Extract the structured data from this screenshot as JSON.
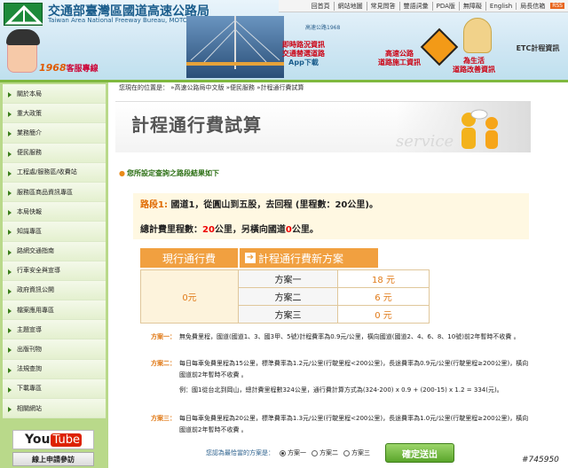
{
  "header": {
    "org_title": "交通部臺灣區國道高速公路局",
    "org_subtitle": "Taiwan Area National Freeway Bureau, MOTC",
    "hotline_label": "客服專線",
    "hotline_number": "1968",
    "app_tag": "高速公路1968",
    "promo_app": "App下載",
    "promo_app_line1": "即時路況資訊",
    "promo_app_line2": "交通替選道路",
    "promo_road_line1": "高速公路",
    "promo_road_line2": "道路施工資訊",
    "promo_etc": "ETC計程資訊",
    "promo_life_line1": "為生活",
    "promo_life_line2": "道路改善資訊"
  },
  "topnav": {
    "items": [
      "回首頁",
      "網站地圖",
      "常見問答",
      "雙語詞彙",
      "PDA版",
      "無障礙",
      "English",
      "局長信箱"
    ],
    "rss": "RSS"
  },
  "sidebar": {
    "items": [
      "關於本局",
      "重大政策",
      "業務簡介",
      "便民服務",
      "工程處/服務區/收費站",
      "服務區商品資訊專區",
      "本局快報",
      "知識專區",
      "路網交通指南",
      "行車安全與宣導",
      "政府資訊公開",
      "檔案應用專區",
      "主題宣導",
      "出版刊物",
      "法規查詢",
      "下載專區",
      "相關網站"
    ],
    "youtube_you": "You",
    "youtube_tube": "Tube",
    "apply_label": "線上申請參訪"
  },
  "breadcrumb": {
    "prefix": "您現在的位置是：",
    "path": "»高速公路局中文版 »便民服務 »計程通行費試算"
  },
  "banner": {
    "title": "計程通行費試算",
    "service_word": "service"
  },
  "result": {
    "heading": "您所設定查詢之路段結果如下",
    "route_label": "路段1:",
    "route_text": "國道1，從圓山到五股，去回程 (里程數：20公里)。",
    "dist_prefix": "總計費里程數：",
    "dist_value": "20",
    "dist_mid": "公里，另橫向國道",
    "dist_value2": "0",
    "dist_suffix": "公里。"
  },
  "fees": {
    "tab_current": "現行通行費",
    "tab_new": "計程通行費新方案",
    "current_value": "0元",
    "plans": [
      {
        "name": "方案一",
        "value": "18 元"
      },
      {
        "name": "方案二",
        "value": "6 元"
      },
      {
        "name": "方案三",
        "value": "0 元"
      }
    ]
  },
  "notes": {
    "n1_label": "方案一：",
    "n1_text": "無免費里程，國道(國道1、3、國3甲、5號)計程費率為0.9元/公里，橫向國道(國道2、4、6、8、10號)前2年暫時不收費 。",
    "n2_label": "方案二：",
    "n2_text": "每日每車免費里程為15公里，標準費率為1.2元/公里(行駛里程<200公里)，長途費率為0.9元/公里(行駛里程≥200公里)，橫向國道前2年暫時不收費 。",
    "n3_text": "例：國1從台北到岡山，總計費里程數324公里，通行費計算方式為(324-200) x 0.9 + (200-15) x 1.2 = 334(元)。",
    "n4_label": "方案三：",
    "n4_text": "每日每車免費里程為20公里，標準費率為1.3元/公里(行駛里程<200公里)，長途費率為1.0元/公里(行駛里程≥200公里)，橫向國道前2年暫時不收費 。"
  },
  "choose": {
    "label": "您認為最恰當的方案是：",
    "options": [
      "方案一",
      "方案二",
      "方案三"
    ],
    "selected": "方案一",
    "confirm_label": "確定送出"
  },
  "watermark": "#745950"
}
